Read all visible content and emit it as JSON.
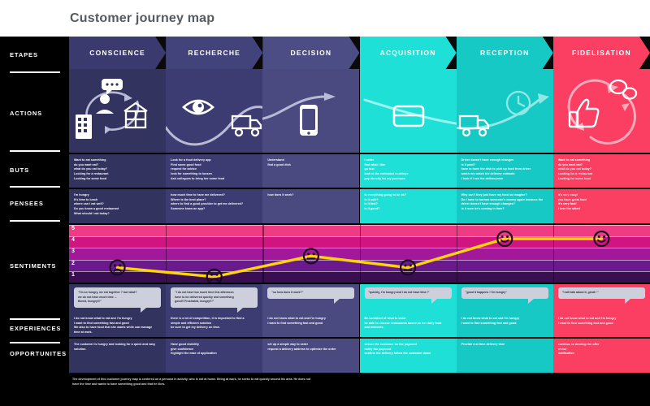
{
  "header": {
    "title": "Customer journey map"
  },
  "colors": {
    "stage_conscience": "#3a3a6e",
    "stage_recherche": "#43437c",
    "stage_decision": "#4d4d85",
    "stage_acquisition": "#1fe0d6",
    "stage_reception": "#17c9c4",
    "stage_fidelisation": "#fa3f62",
    "rail_bg": "#000000",
    "title_color": "#555a60",
    "line_color": "#ffd40a",
    "bubble_bg": "#cdd0dc"
  },
  "rail": {
    "items": [
      {
        "label": "ETAPES"
      },
      {
        "label": "ACTIONS"
      },
      {
        "label": "BUTS"
      },
      {
        "label": "PENSEES"
      },
      {
        "label": "SENTIMENTS"
      },
      {
        "label": "EXPERIENCES"
      },
      {
        "label": "OPPORTUNITES"
      }
    ]
  },
  "stages": [
    {
      "label": "CONSCIENCE"
    },
    {
      "label": "RECHERCHE"
    },
    {
      "label": "DECISION"
    },
    {
      "label": "ACQUISITION"
    },
    {
      "label": "RECEPTION"
    },
    {
      "label": "FIDELISATION"
    }
  ],
  "actions": [
    {
      "icons": [
        "office-building-icon",
        "person-speech-bubble-icon",
        "house-icon",
        "circular-arrows-icon"
      ]
    },
    {
      "icons": [
        "eye-icon",
        "delivery-truck-icon"
      ]
    },
    {
      "icons": [
        "smartphone-icon",
        "arrow-icon"
      ]
    },
    {
      "icons": [
        "credit-card-icon"
      ]
    },
    {
      "icons": [
        "delivery-truck-icon",
        "clock-icon"
      ]
    },
    {
      "icons": [
        "thumbs-up-icon",
        "speech-bubbles-icon",
        "circular-arrows-icon"
      ]
    }
  ],
  "buts": [
    {
      "lines": [
        "Want to eat something",
        "do you want eat?",
        "what do you eat today?",
        "Looking for a restaurant",
        "Looking for some food"
      ]
    },
    {
      "lines": [
        "Look for a  food delivery app",
        "Find some good food",
        "request for advice",
        "look for something to loosen",
        "Ask collegues to bring her some food"
      ]
    },
    {
      "lines": [
        "Understand",
        "find a good dish"
      ]
    },
    {
      "lines": [
        "I order",
        "find what I like",
        "go fast",
        "look at the estimated re-delays",
        "pay directly for my purchase"
      ]
    },
    {
      "lines": [
        "Driver doesn't have enough changes",
        "is it paid?",
        "have to have the dish to pick up food from driver",
        "watch my watch the delivery estimate",
        "I look if I see the deliverymen"
      ]
    },
    {
      "lines": [
        "Want to eat something",
        "do you want eat?",
        "what do you eat today?",
        "Looking for a restaurant",
        "Looking for some food"
      ]
    }
  ],
  "pensees": [
    {
      "lines": [
        "I'm hungry",
        "It's time to lunch",
        "where can I eat well?",
        "Do you know a good restaurant",
        "What should I eat today?"
      ]
    },
    {
      "lines": [
        "how much time to have me delivered?",
        "Where is the best place?",
        "where to find a good provider to get me delivered?",
        "Someone know an app?"
      ]
    },
    {
      "lines": [
        "how does it work?"
      ]
    },
    {
      "lines": [
        "is everything going to be ok?",
        "is it safe?",
        "is it fast?",
        "is it good?"
      ]
    },
    {
      "lines": [
        "Why can't they just have my food so imagine?",
        "Do I have to borrow someone's money again because the driver doesn't have enough changes?",
        "is it sure he's coming in time?"
      ]
    },
    {
      "lines": [
        "it's very easy!",
        "you have great food",
        "it's very fast!",
        "I love the sitter!"
      ]
    }
  ],
  "chart_data": {
    "type": "line",
    "title": "SENTIMENTS",
    "categories": [
      "CONSCIENCE",
      "RECHERCHE",
      "DECISION",
      "ACQUISITION",
      "RECEPTION",
      "FIDELISATION"
    ],
    "values": [
      1.8,
      1.0,
      2.8,
      1.8,
      4.3,
      4.3
    ],
    "faces": [
      "sad",
      "sad",
      "neutral",
      "neutral",
      "happy",
      "happy"
    ],
    "ylim": [
      1,
      5
    ],
    "ytick_labels": [
      "1",
      "2",
      "3",
      "4",
      "5"
    ],
    "xlabel": "",
    "ylabel": "",
    "grid": true,
    "legend": "none",
    "line_color": "#ffd40a",
    "band_colors": [
      "#3a0f52",
      "#6a1a8c",
      "#a3179a",
      "#d11580",
      "#ee3b83",
      "#f45f9e"
    ]
  },
  "experiences": [
    {
      "bubble": [
        "\"I'm so hungry, we eat together ? but what?",
        "we do not have much time ...",
        "Bored, hungry!!!\""
      ],
      "note": [
        "I do not know what to eat and I'm hungry",
        "I want to find something fast and good",
        "We also to have food that she wants while can manage",
        "time at work."
      ]
    },
    {
      "bubble": [
        "\"I do not have too much time this afternoon",
        "have to be delivered quickly and something",
        "good!! Frustrated, hungry!!!\""
      ],
      "note": [
        "there is a lot of competition, it is important to find a",
        "simple and efficient solution",
        "be sure to get my delivery on time."
      ]
    },
    {
      "bubble": [
        "\"so how does it work?\""
      ],
      "note": [
        "I do not know what to eat and I'm hungry",
        "I want to find something fast and good"
      ]
    },
    {
      "bubble": [
        "\"quickly, I'm hungry and I do not have time !\""
      ],
      "note": [
        "Be confident of what to order",
        "be able to choose restaurants based on her daily food",
        "and interests."
      ]
    },
    {
      "bubble": [
        "\"good it happens ! I'm hungry\""
      ],
      "note": [
        "I do not know what to eat and I'm hungry",
        "I want to find something fast and good"
      ]
    },
    {
      "bubble": [
        "\"I will talk about it, great ! \""
      ],
      "note": [
        "I do not know what to eat and I'm hungry",
        "I want to find something fast and good"
      ]
    }
  ],
  "opportunites": [
    {
      "lines": [
        "The customer is hungry and looking for a quick and easy",
        "solution."
      ]
    },
    {
      "lines": [
        "Have good visibility",
        "give confidence",
        "highlight the ease of application"
      ]
    },
    {
      "lines": [
        "set up a simple way to order",
        "request a delivery address to optimize the order"
      ]
    },
    {
      "lines": [
        "secure the customer on the payment",
        "notify the payment",
        "confirm the delivery follow the customer down"
      ]
    },
    {
      "lines": [
        "Provide real time delivery time"
      ]
    },
    {
      "lines": [
        "continue to develop the offer",
        "revise",
        "notification"
      ]
    }
  ],
  "footer": {
    "text": "The development of this customer journey map is centered on a persona in activity, who is not at home. Being at work, he seeks to eat quickly around his area. He does not have the time and wants to have something good and that he likes."
  }
}
